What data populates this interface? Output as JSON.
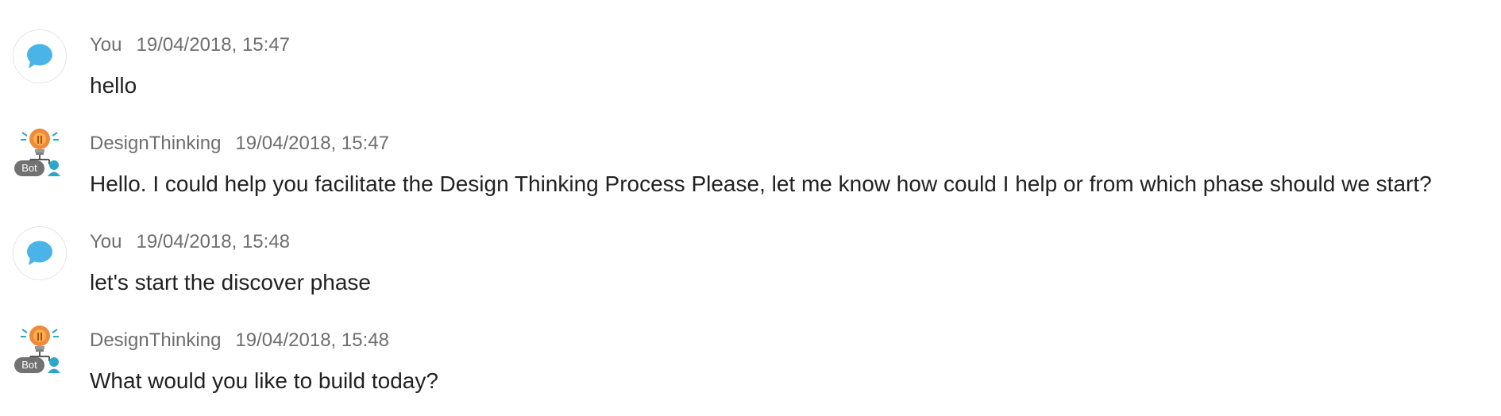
{
  "messages": [
    {
      "author": "You",
      "timestamp": "19/04/2018, 15:47",
      "text": "hello",
      "avatar_icon": "chat-bubble-icon"
    },
    {
      "author": "DesignThinking",
      "timestamp": "19/04/2018, 15:47",
      "text": "Hello. I could help you facilitate the Design Thinking Process Please, let me know how could I help or from which phase should we start?",
      "avatar_icon": "bot-lightbulb-icon",
      "badge": "Bot"
    },
    {
      "author": "You",
      "timestamp": "19/04/2018, 15:48",
      "text": "let's start the discover phase",
      "avatar_icon": "chat-bubble-icon"
    },
    {
      "author": "DesignThinking",
      "timestamp": "19/04/2018, 15:48",
      "text": "What would you like to build today?",
      "avatar_icon": "bot-lightbulb-icon",
      "badge": "Bot"
    }
  ],
  "colors": {
    "user_icon": "#4ab3e8",
    "bot_bulb": "#f08a3a",
    "bot_accent": "#2ea6c9",
    "meta_text": "#6e6e6e",
    "message_text": "#222222",
    "badge_bg": "#727272"
  }
}
